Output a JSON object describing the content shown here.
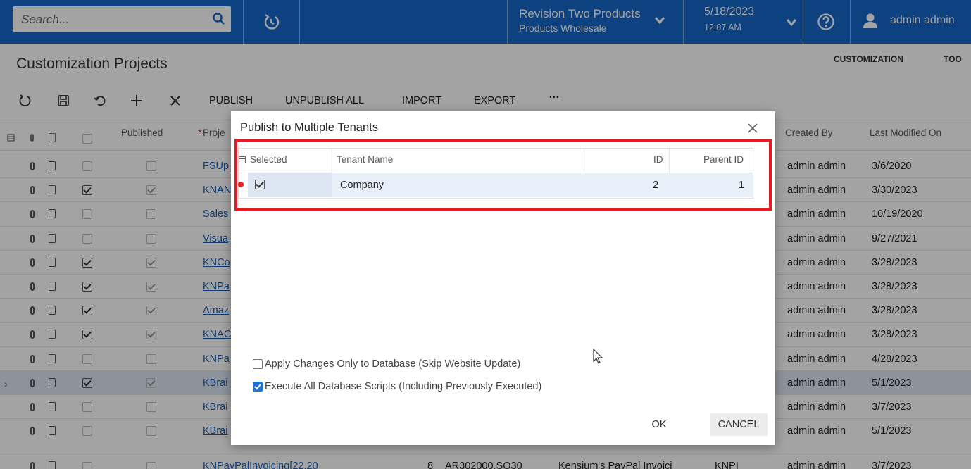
{
  "topbar": {
    "search_placeholder": "Search...",
    "company_line1": "Revision Two Products",
    "company_line2": "Products Wholesale",
    "date": "5/18/2023",
    "time": "12:07 AM",
    "user": "admin admin"
  },
  "page": {
    "title": "Customization Projects",
    "nav_customization": "CUSTOMIZATION",
    "nav_tools": "TOO"
  },
  "toolbar": {
    "publish": "PUBLISH",
    "unpublish_all": "UNPUBLISH ALL",
    "import": "IMPORT",
    "export": "EXPORT",
    "more": "···"
  },
  "grid": {
    "headers": {
      "published": "Published",
      "project_name": "Proje",
      "required_mark": "*",
      "created_by": "Created By",
      "last_modified": "Last Modified On"
    },
    "rows": [
      {
        "active": false,
        "checked": false,
        "published": false,
        "name": "FSUp",
        "created_by": "admin admin",
        "modified": "3/6/2020"
      },
      {
        "active": false,
        "checked": true,
        "published": true,
        "name": "KNAN",
        "created_by": "admin admin",
        "modified": "3/30/2023"
      },
      {
        "active": false,
        "checked": false,
        "published": false,
        "name": "Sales",
        "created_by": "admin admin",
        "modified": "10/19/2020"
      },
      {
        "active": false,
        "checked": false,
        "published": false,
        "name": "Visua",
        "created_by": "admin admin",
        "modified": "9/27/2021"
      },
      {
        "active": false,
        "checked": true,
        "published": true,
        "name": "KNCo",
        "created_by": "admin admin",
        "modified": "3/28/2023"
      },
      {
        "active": false,
        "checked": true,
        "published": true,
        "name": "KNPa",
        "created_by": "admin admin",
        "modified": "3/28/2023"
      },
      {
        "active": false,
        "checked": true,
        "published": true,
        "name": "Amaz",
        "created_by": "admin admin",
        "modified": "3/28/2023"
      },
      {
        "active": false,
        "checked": true,
        "published": true,
        "name": "KNAC",
        "created_by": "admin admin",
        "modified": "3/28/2023"
      },
      {
        "active": false,
        "checked": false,
        "published": false,
        "name": "KNPa",
        "created_by": "admin admin",
        "modified": "4/28/2023"
      },
      {
        "active": true,
        "checked": true,
        "published": true,
        "name": "KBrai",
        "created_by": "admin admin",
        "modified": "5/1/2023"
      },
      {
        "active": false,
        "checked": false,
        "published": false,
        "name": "KBrai",
        "created_by": "admin admin",
        "modified": "3/7/2023"
      },
      {
        "active": false,
        "checked": false,
        "published": false,
        "name": "KBrai",
        "created_by": "admin admin",
        "modified": "5/1/2023"
      }
    ],
    "partial_row": {
      "name": "KNPayPalInvoicing[22.20",
      "level": "8",
      "screens": "AR302000,SO30",
      "description": "Kensium's PayPal Invoici",
      "prefix": "KNPI",
      "created_by": "admin admin",
      "modified": "3/7/2023"
    }
  },
  "dialog": {
    "title": "Publish to Multiple Tenants",
    "columns": {
      "selected": "Selected",
      "tenant_name": "Tenant Name",
      "id": "ID",
      "parent_id": "Parent ID"
    },
    "tenants": [
      {
        "selected": true,
        "tenant_name": "Company",
        "id": "2",
        "parent_id": "1"
      }
    ],
    "option_apply_db_only": "Apply Changes Only to Database (Skip Website Update)",
    "option_apply_db_only_checked": false,
    "option_execute_all": "Execute All Database Scripts (Including Previously Executed)",
    "option_execute_all_checked": true,
    "ok": "OK",
    "cancel": "CANCEL"
  }
}
